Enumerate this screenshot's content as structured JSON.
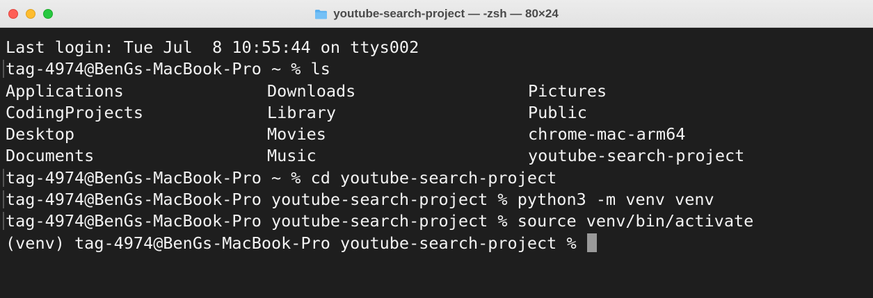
{
  "window": {
    "title": "youtube-search-project — -zsh — 80×24"
  },
  "terminal": {
    "last_login": "Last login: Tue Jul  8 10:55:44 on ttys002",
    "cmd_ls": "tag-4974@BenGs-MacBook-Pro ~ % ls",
    "ls_output": [
      [
        "Applications",
        "Downloads",
        "Pictures"
      ],
      [
        "CodingProjects",
        "Library",
        "Public"
      ],
      [
        "Desktop",
        "Movies",
        "chrome-mac-arm64"
      ],
      [
        "Documents",
        "Music",
        "youtube-search-project"
      ]
    ],
    "cmd_cd": "tag-4974@BenGs-MacBook-Pro ~ % cd youtube-search-project",
    "cmd_venv": "tag-4974@BenGs-MacBook-Pro youtube-search-project % python3 -m venv venv",
    "cmd_source": "tag-4974@BenGs-MacBook-Pro youtube-search-project % source venv/bin/activate",
    "current_prompt": "(venv) tag-4974@BenGs-MacBook-Pro youtube-search-project % "
  },
  "colors": {
    "terminal_bg": "#1e1e1e",
    "terminal_fg": "#f2f2f2",
    "titlebar_bg": "#e6e6e6",
    "close": "#fe5f57",
    "minimize": "#febc2e",
    "zoom": "#28c840",
    "folder": "#5ab0f0"
  },
  "icons": {
    "title_icon": "folder-icon"
  }
}
